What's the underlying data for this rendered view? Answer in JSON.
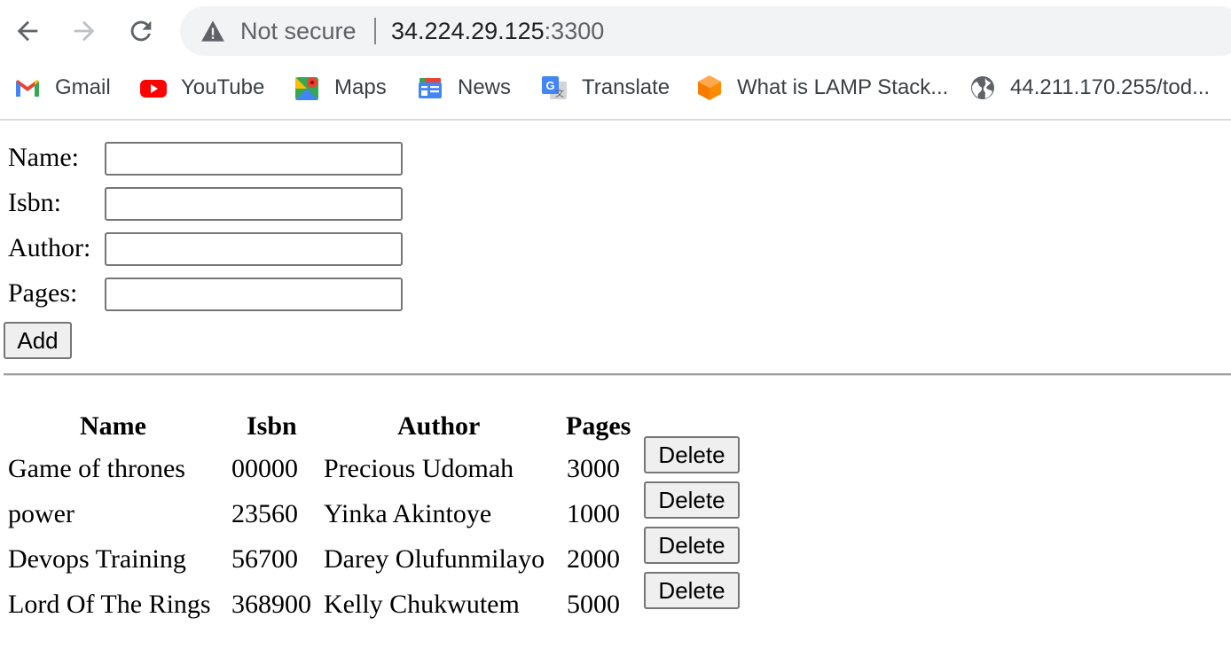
{
  "browser": {
    "not_secure_label": "Not secure",
    "url_host": "34.224.29.125",
    "url_port": ":3300",
    "bookmarks": [
      {
        "label": "Gmail",
        "icon": "gmail-icon"
      },
      {
        "label": "YouTube",
        "icon": "youtube-icon"
      },
      {
        "label": "Maps",
        "icon": "maps-icon"
      },
      {
        "label": "News",
        "icon": "news-icon"
      },
      {
        "label": "Translate",
        "icon": "translate-icon"
      },
      {
        "label": "What is LAMP Stack...",
        "icon": "cube-icon"
      },
      {
        "label": "44.211.170.255/tod...",
        "icon": "globe-icon"
      }
    ]
  },
  "form": {
    "name_label": "Name:",
    "isbn_label": "Isbn:",
    "author_label": "Author:",
    "pages_label": "Pages:",
    "name_value": "",
    "isbn_value": "",
    "author_value": "",
    "pages_value": "",
    "add_label": "Add"
  },
  "table": {
    "headers": [
      "Name",
      "Isbn",
      "Author",
      "Pages"
    ],
    "delete_label": "Delete",
    "rows": [
      {
        "name": "Game of thrones",
        "isbn": "00000",
        "author": "Precious Udomah",
        "pages": "3000"
      },
      {
        "name": "power",
        "isbn": "23560",
        "author": "Yinka Akintoye",
        "pages": "1000"
      },
      {
        "name": "Devops Training",
        "isbn": "56700",
        "author": "Darey Olufunmilayo",
        "pages": "2000"
      },
      {
        "name": "Lord Of The Rings",
        "isbn": "368900",
        "author": "Kelly Chukwutem",
        "pages": "5000"
      }
    ]
  },
  "colors": {
    "omnibox_bg": "#f1f3f4",
    "button_bg": "#efefef",
    "input_border": "#767676"
  }
}
